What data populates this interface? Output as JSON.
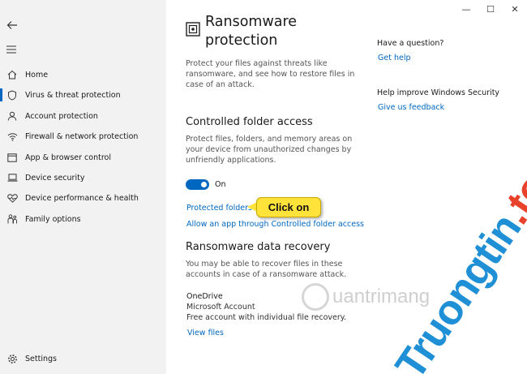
{
  "sidebar": {
    "items": [
      {
        "label": "Home",
        "icon": "home-icon"
      },
      {
        "label": "Virus & threat protection",
        "icon": "shield-icon"
      },
      {
        "label": "Account protection",
        "icon": "person-icon"
      },
      {
        "label": "Firewall & network protection",
        "icon": "wifi-icon"
      },
      {
        "label": "App & browser control",
        "icon": "window-icon"
      },
      {
        "label": "Device security",
        "icon": "laptop-icon"
      },
      {
        "label": "Device performance & health",
        "icon": "heart-icon"
      },
      {
        "label": "Family options",
        "icon": "family-icon"
      }
    ],
    "settings_label": "Settings"
  },
  "main": {
    "title": "Ransomware protection",
    "intro": "Protect your files against threats like ransomware, and see how to restore files in case of an attack.",
    "cfa": {
      "heading": "Controlled folder access",
      "desc": "Protect files, folders, and memory areas on your device from unauthorized changes by unfriendly applications.",
      "toggle_label": "On",
      "toggle_on": true,
      "protected_folders_link": "Protected folders",
      "allow_app_link": "Allow an app through Controlled folder access"
    },
    "recovery": {
      "heading": "Ransomware data recovery",
      "desc": "You may be able to recover files in these accounts in case of a ransomware attack.",
      "provider": "OneDrive",
      "account_type": "Microsoft Account",
      "account_desc": "Free account with individual file recovery.",
      "view_files_link": "View files"
    }
  },
  "aside": {
    "question_heading": "Have a question?",
    "help_link": "Get help",
    "improve_heading": "Help improve Windows Security",
    "feedback_link": "Give us feedback"
  },
  "callout": {
    "text": "Click on"
  },
  "watermark": {
    "brand_main": "Truongtin",
    "brand_tld": ".top",
    "quantri_text": "uantrimang"
  },
  "colors": {
    "accent": "#0067c0",
    "callout": "#ffe23a"
  }
}
